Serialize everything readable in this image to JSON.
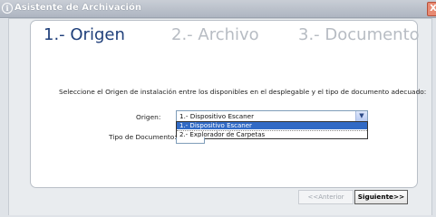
{
  "window": {
    "title": "Asistente de Archivación",
    "close_symbol": "X"
  },
  "steps": [
    {
      "label": "1.- Origen",
      "state": "active"
    },
    {
      "label": "2.- Archivo",
      "state": "inactive"
    },
    {
      "label": "3.- Documento",
      "state": "inactive"
    }
  ],
  "instruction": "Seleccione el Origen de instalación entre los disponibles en el desplegable y el tipo de documento adecuado:",
  "form": {
    "origen_label": "Origen:",
    "origen_selected": "1.- Dispositivo Escaner",
    "origen_options": [
      "1.- Dispositivo Escaner",
      "2.- Explorador de Carpetas"
    ],
    "tipo_label": "Tipo de Documento:"
  },
  "buttons": {
    "prev": "<<Anterior",
    "next": "Siguiente>>"
  },
  "colors": {
    "active_step": "#1f3f7a",
    "inactive_step": "#b7bcc3",
    "selection": "#316ac5"
  }
}
